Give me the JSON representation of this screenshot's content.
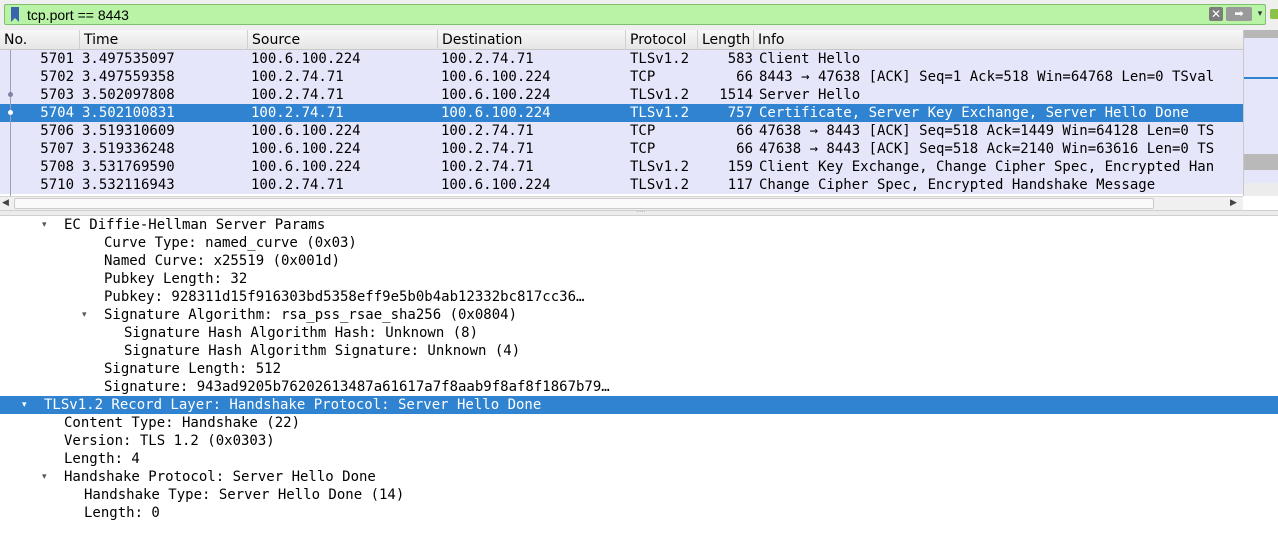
{
  "filter": {
    "value": "tcp.port == 8443",
    "clear_glyph": "✕",
    "apply_glyph": "➡",
    "history_glyph": "▾",
    "icons": [
      "bookmark-icon",
      "clear-filter-icon",
      "apply-filter-icon",
      "filter-history-icon",
      "add-filter-icon"
    ]
  },
  "colors": {
    "filter_valid": "#b9f3a6",
    "row_tls_tcp": "#e6e6fa",
    "selection": "#2f83d0"
  },
  "packet_list": {
    "columns": [
      "No.",
      "Time",
      "Source",
      "Destination",
      "Protocol",
      "Length",
      "Info"
    ],
    "selected_no": "5704",
    "rows": [
      {
        "no": "5701",
        "time": "3.497535097",
        "source": "100.6.100.224",
        "destination": "100.2.74.71",
        "protocol": "TLSv1.2",
        "length": "583",
        "info": "Client Hello"
      },
      {
        "no": "5702",
        "time": "3.497559358",
        "source": "100.2.74.71",
        "destination": "100.6.100.224",
        "protocol": "TCP",
        "length": "66",
        "info": "8443 → 47638 [ACK] Seq=1 Ack=518 Win=64768 Len=0 TSval"
      },
      {
        "no": "5703",
        "time": "3.502097808",
        "source": "100.2.74.71",
        "destination": "100.6.100.224",
        "protocol": "TLSv1.2",
        "length": "1514",
        "info": "Server Hello"
      },
      {
        "no": "5704",
        "time": "3.502100831",
        "source": "100.2.74.71",
        "destination": "100.6.100.224",
        "protocol": "TLSv1.2",
        "length": "757",
        "info": "Certificate, Server Key Exchange, Server Hello Done"
      },
      {
        "no": "5706",
        "time": "3.519310609",
        "source": "100.6.100.224",
        "destination": "100.2.74.71",
        "protocol": "TCP",
        "length": "66",
        "info": "47638 → 8443 [ACK] Seq=518 Ack=1449 Win=64128 Len=0 TS"
      },
      {
        "no": "5707",
        "time": "3.519336248",
        "source": "100.6.100.224",
        "destination": "100.2.74.71",
        "protocol": "TCP",
        "length": "66",
        "info": "47638 → 8443 [ACK] Seq=518 Ack=2140 Win=63616 Len=0 TS"
      },
      {
        "no": "5708",
        "time": "3.531769590",
        "source": "100.6.100.224",
        "destination": "100.2.74.71",
        "protocol": "TLSv1.2",
        "length": "159",
        "info": "Client Key Exchange, Change Cipher Spec, Encrypted Han"
      },
      {
        "no": "5710",
        "time": "3.532116943",
        "source": "100.2.74.71",
        "destination": "100.6.100.224",
        "protocol": "TLSv1.2",
        "length": "117",
        "info": "Change Cipher Spec, Encrypted Handshake Message"
      }
    ]
  },
  "details": {
    "rows": [
      {
        "text": "EC Diffie-Hellman Server Params",
        "level": 3,
        "arrow": "▾",
        "selected": false
      },
      {
        "text": "Curve Type: named_curve (0x03)",
        "level": 5,
        "arrow": "",
        "selected": false
      },
      {
        "text": "Named Curve: x25519 (0x001d)",
        "level": 5,
        "arrow": "",
        "selected": false
      },
      {
        "text": "Pubkey Length: 32",
        "level": 5,
        "arrow": "",
        "selected": false
      },
      {
        "text": "Pubkey: 928311d15f916303bd5358eff9e5b0b4ab12332bc817cc36…",
        "level": 5,
        "arrow": "",
        "selected": false
      },
      {
        "text": "Signature Algorithm: rsa_pss_rsae_sha256 (0x0804)",
        "level": 5,
        "arrow": "▾",
        "selected": false
      },
      {
        "text": "Signature Hash Algorithm Hash: Unknown (8)",
        "level": 6,
        "arrow": "",
        "selected": false
      },
      {
        "text": "Signature Hash Algorithm Signature: Unknown (4)",
        "level": 6,
        "arrow": "",
        "selected": false
      },
      {
        "text": "Signature Length: 512",
        "level": 5,
        "arrow": "",
        "selected": false
      },
      {
        "text": "Signature: 943ad9205b76202613487a61617a7f8aab9f8af8f1867b79…",
        "level": 5,
        "arrow": "",
        "selected": false
      },
      {
        "text": "TLSv1.2 Record Layer: Handshake Protocol: Server Hello Done",
        "level": 2,
        "arrow": "▾",
        "selected": true
      },
      {
        "text": "Content Type: Handshake (22)",
        "level": 3,
        "arrow": "",
        "selected": false
      },
      {
        "text": "Version: TLS 1.2 (0x0303)",
        "level": 3,
        "arrow": "",
        "selected": false
      },
      {
        "text": "Length: 4",
        "level": 3,
        "arrow": "",
        "selected": false
      },
      {
        "text": "Handshake Protocol: Server Hello Done",
        "level": 3,
        "arrow": "▾",
        "selected": false
      },
      {
        "text": "Handshake Type: Server Hello Done (14)",
        "level": 4,
        "arrow": "",
        "selected": false
      },
      {
        "text": "Length: 0",
        "level": 4,
        "arrow": "",
        "selected": false
      }
    ]
  }
}
